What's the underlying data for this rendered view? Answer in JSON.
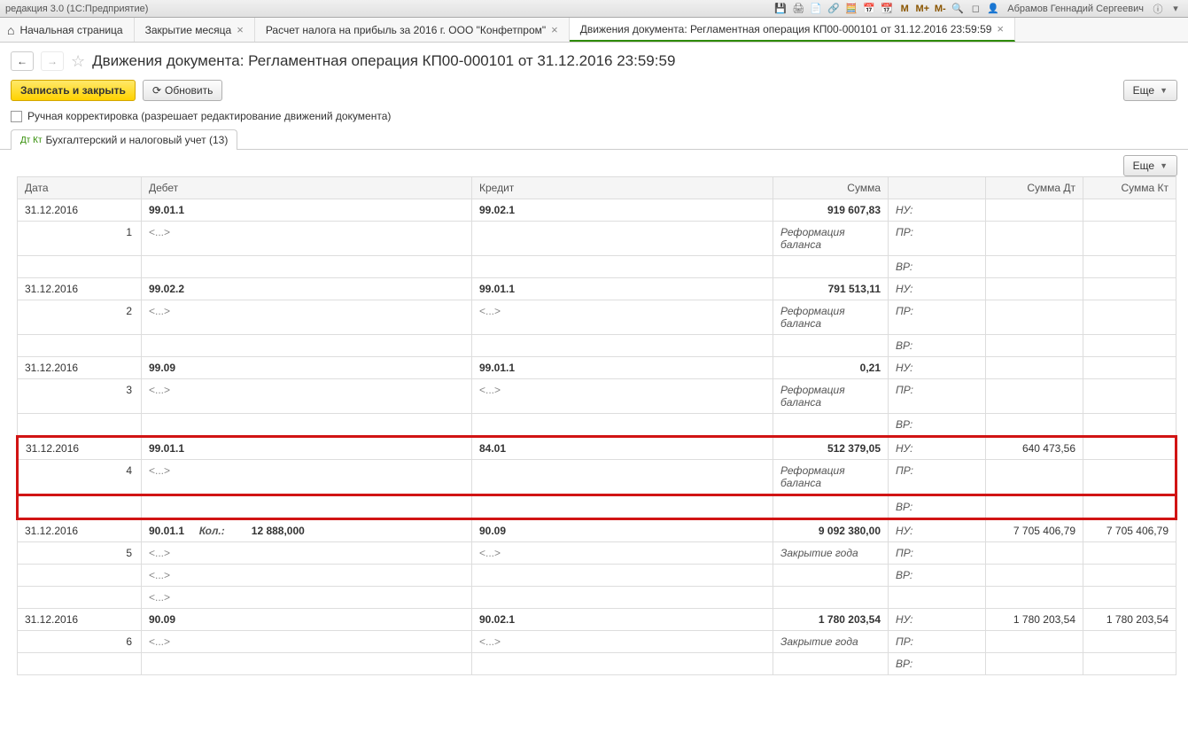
{
  "app_title": "редакция 3.0  (1С:Предприятие)",
  "user_name": "Абрамов Геннадий Сергеевич",
  "toolbar_icons": {
    "m": "M",
    "mplus": "M+",
    "mminus": "M-"
  },
  "tabs": [
    {
      "label": "Начальная страница",
      "closable": false
    },
    {
      "label": "Закрытие месяца",
      "closable": true
    },
    {
      "label": "Расчет налога на прибыль за 2016 г. ООО \"Конфетпром\"",
      "closable": true
    },
    {
      "label": "Движения документа: Регламентная операция КП00-000101 от 31.12.2016 23:59:59",
      "closable": true,
      "active": true
    }
  ],
  "page_title": "Движения документа: Регламентная операция КП00-000101 от 31.12.2016 23:59:59",
  "buttons": {
    "save_close": "Записать и закрыть",
    "refresh": "Обновить",
    "more": "Еще",
    "more2": "Еще"
  },
  "manual_edit_label": "Ручная корректировка (разрешает редактирование движений документа)",
  "subtab_label": "Бухгалтерский и налоговый учет (13)",
  "columns": {
    "date": "Дата",
    "debit": "Дебет",
    "credit": "Кредит",
    "sum": "Сумма",
    "sum_dt": "Сумма Дт",
    "sum_kt": "Сумма Кт"
  },
  "flags": {
    "nu": "НУ:",
    "pr": "ПР:",
    "vr": "ВР:"
  },
  "placeholder": "<...>",
  "kol_label": "Кол.:",
  "rows": [
    {
      "n": "1",
      "date": "31.12.2016",
      "debit": "99.01.1",
      "credit": "99.02.1",
      "sum": "919 607,83",
      "desc": "Реформация баланса"
    },
    {
      "n": "2",
      "date": "31.12.2016",
      "debit": "99.02.2",
      "credit": "99.01.1",
      "sum": "791 513,11",
      "desc": "Реформация баланса",
      "credit_sub": "<...>"
    },
    {
      "n": "3",
      "date": "31.12.2016",
      "debit": "99.09",
      "credit": "99.01.1",
      "sum": "0,21",
      "desc": "Реформация баланса",
      "credit_sub": "<...>"
    },
    {
      "n": "4",
      "date": "31.12.2016",
      "debit": "99.01.1",
      "credit": "84.01",
      "sum": "512 379,05",
      "desc": "Реформация баланса",
      "sum_dt": "640 473,56",
      "highlight": true
    },
    {
      "n": "5",
      "date": "31.12.2016",
      "debit": "90.01.1",
      "credit": "90.09",
      "kol": "12 888,000",
      "sum": "9 092 380,00",
      "desc": "Закрытие года",
      "sum_dt": "7 705 406,79",
      "sum_kt": "7 705 406,79",
      "credit_sub": "<...>",
      "extra_subs": 2
    },
    {
      "n": "6",
      "date": "31.12.2016",
      "debit": "90.09",
      "credit": "90.02.1",
      "sum": "1 780 203,54",
      "desc": "Закрытие года",
      "sum_dt": "1 780 203,54",
      "sum_kt": "1 780 203,54",
      "credit_sub": "<...>"
    }
  ]
}
